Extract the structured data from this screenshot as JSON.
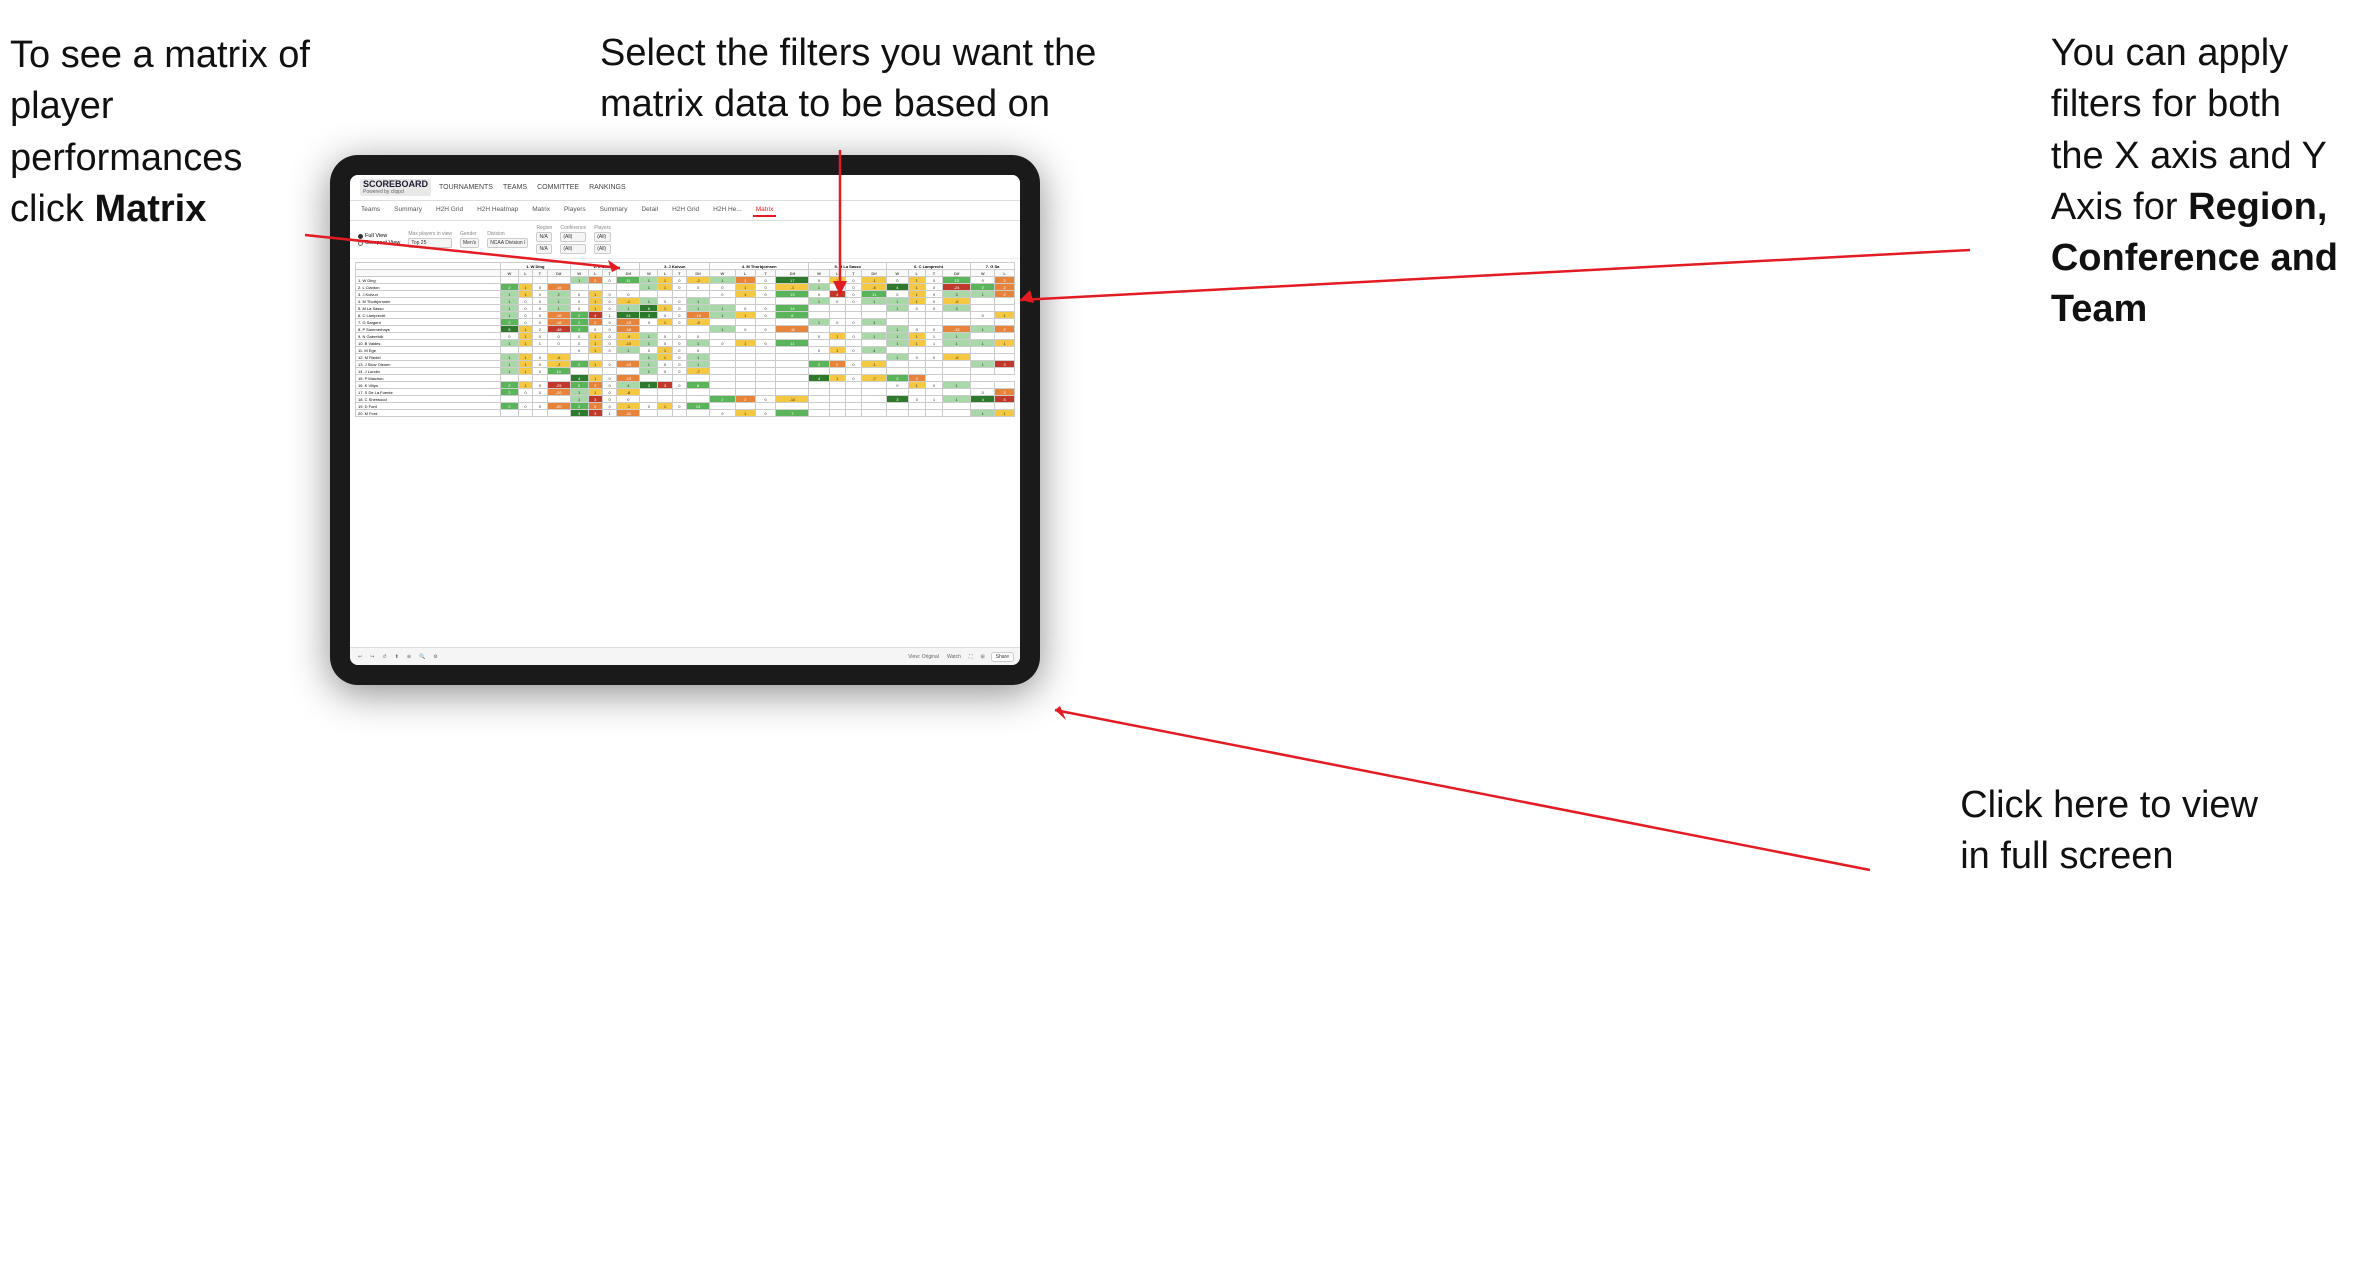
{
  "annotations": {
    "top_left": {
      "line1": "To see a matrix of",
      "line2": "player performances",
      "line3_prefix": "click ",
      "line3_bold": "Matrix"
    },
    "top_center": {
      "line1": "Select the filters you want the",
      "line2": "matrix data to be based on"
    },
    "top_right": {
      "line1": "You  can apply",
      "line2": "filters for both",
      "line3": "the X axis and Y",
      "line4_prefix": "Axis for ",
      "line4_bold": "Region,",
      "line5_bold": "Conference and",
      "line6_bold": "Team"
    },
    "bottom_right": {
      "line1": "Click here to view",
      "line2": "in full screen"
    }
  },
  "scoreboard": {
    "title": "SCOREBOARD",
    "subtitle": "Powered by clippd"
  },
  "nav": {
    "items": [
      "TOURNAMENTS",
      "TEAMS",
      "COMMITTEE",
      "RANKINGS"
    ]
  },
  "tabs": {
    "items": [
      "Teams",
      "Summary",
      "H2H Grid",
      "H2H Heatmap",
      "Matrix",
      "Players",
      "Summary",
      "Detail",
      "H2H Grid",
      "H2H He...",
      "Matrix"
    ],
    "active_index": 10
  },
  "filters": {
    "view_options": [
      "Full View",
      "Compact View"
    ],
    "selected_view": "Full View",
    "max_players_label": "Max players in view",
    "max_players_value": "Top 25",
    "gender_label": "Gender",
    "gender_value": "Men's",
    "division_label": "Division",
    "division_value": "NCAA Division I",
    "region_label": "Region",
    "region_value": "N/A",
    "conference_label": "Conference",
    "conference_value": "(All)",
    "players_label": "Players",
    "players_value": "(All)"
  },
  "matrix": {
    "col_headers": [
      "1. W Ding",
      "2. L Clanton",
      "3. J Koivun",
      "4. M Thorbjornsen",
      "5. M La Sasso",
      "6. C Lamprecht",
      "7. G Sa"
    ],
    "sub_headers": [
      "W",
      "L",
      "T",
      "Dif"
    ],
    "rows": [
      {
        "name": "1. W Ding",
        "cells": [
          [
            null,
            null,
            null,
            null
          ],
          [
            1,
            2,
            0,
            11
          ],
          [
            1,
            1,
            0,
            -2
          ],
          [
            1,
            2,
            0,
            17
          ],
          [
            0,
            1,
            0,
            -1
          ],
          [
            0,
            1,
            0,
            13
          ],
          [
            0,
            2
          ]
        ]
      },
      {
        "name": "2. L Clanton",
        "cells": [
          [
            2,
            1,
            0,
            -16
          ],
          [
            null,
            null,
            null,
            null
          ],
          [
            1,
            1,
            0,
            0
          ],
          [
            0,
            1,
            0,
            -1
          ],
          [
            1,
            0,
            0,
            -6
          ],
          [
            4,
            1,
            0,
            -24
          ],
          [
            2,
            2
          ]
        ]
      },
      {
        "name": "3. J Koivun",
        "cells": [
          [
            1,
            1,
            0,
            2
          ],
          [
            0,
            1,
            0,
            0
          ],
          [
            null,
            null,
            null,
            null
          ],
          [
            0,
            1,
            0,
            13
          ],
          [
            0,
            4,
            0,
            11
          ],
          [
            0,
            1,
            0,
            3
          ],
          [
            1,
            2
          ]
        ]
      },
      {
        "name": "4. M Thorbjornsen",
        "cells": [
          [
            1,
            0,
            0,
            1
          ],
          [
            0,
            1,
            0,
            -1
          ],
          [
            1,
            0,
            0,
            1
          ],
          [
            null,
            null,
            null,
            null
          ],
          [
            1,
            0,
            0,
            1
          ],
          [
            1,
            1,
            0,
            -6
          ],
          [
            null,
            null
          ]
        ]
      },
      {
        "name": "5. M La Sasso",
        "cells": [
          [
            1,
            0,
            0,
            1
          ],
          [
            0,
            1,
            0,
            1
          ],
          [
            6,
            1,
            0,
            1
          ],
          [
            1,
            0,
            0,
            14
          ],
          [
            null,
            null,
            null,
            null
          ],
          [
            1,
            0,
            0,
            3
          ],
          [
            null,
            null
          ]
        ]
      },
      {
        "name": "6. C Lamprecht",
        "cells": [
          [
            1,
            0,
            0,
            -16
          ],
          [
            2,
            4,
            1,
            24
          ],
          [
            3,
            0,
            0,
            -16
          ],
          [
            1,
            1,
            0,
            6
          ],
          [
            null,
            null,
            null,
            null
          ],
          [
            null,
            null,
            null,
            null
          ],
          [
            0,
            1
          ]
        ]
      },
      {
        "name": "7. G Sargent",
        "cells": [
          [
            2,
            0,
            0,
            -18
          ],
          [
            2,
            2,
            0,
            -15
          ],
          [
            0,
            1,
            0,
            -5
          ],
          [
            null,
            null,
            null,
            null
          ],
          [
            1,
            0,
            0,
            3
          ],
          [
            null,
            null,
            null,
            null
          ],
          [
            null,
            null
          ]
        ]
      },
      {
        "name": "8. P Summerhays",
        "cells": [
          [
            5,
            1,
            2,
            -48
          ],
          [
            2,
            0,
            0,
            -16
          ],
          [
            null,
            null,
            null,
            null
          ],
          [
            1,
            0,
            0,
            -11
          ],
          [
            null,
            null,
            null,
            null
          ],
          [
            1,
            0,
            0,
            -13
          ],
          [
            1,
            2
          ]
        ]
      },
      {
        "name": "9. N Gabrelcik",
        "cells": [
          [
            0,
            1,
            0,
            0
          ],
          [
            0,
            1,
            0,
            -9
          ],
          [
            1,
            0,
            0,
            0
          ],
          [
            null,
            null,
            null,
            null
          ],
          [
            0,
            1,
            0,
            1
          ],
          [
            1,
            1,
            1,
            1
          ],
          [
            null,
            null
          ]
        ]
      },
      {
        "name": "10. B Valdes",
        "cells": [
          [
            1,
            1,
            1,
            0
          ],
          [
            0,
            1,
            0,
            -10
          ],
          [
            1,
            0,
            0,
            1
          ],
          [
            0,
            1,
            0,
            11
          ],
          [
            null,
            null,
            null,
            null
          ],
          [
            1,
            1,
            1,
            1
          ],
          [
            1,
            1
          ]
        ]
      },
      {
        "name": "11. M Ege",
        "cells": [
          [
            null,
            null,
            null,
            null
          ],
          [
            0,
            1,
            0,
            1
          ],
          [
            0,
            1,
            0,
            0
          ],
          [
            null,
            null,
            null,
            null
          ],
          [
            0,
            1,
            0,
            4
          ],
          [
            null,
            null,
            null,
            null
          ],
          [
            null,
            null
          ]
        ]
      },
      {
        "name": "12. M Riedel",
        "cells": [
          [
            1,
            1,
            0,
            -6
          ],
          [
            null,
            null,
            null,
            null
          ],
          [
            1,
            1,
            0,
            1
          ],
          [
            null,
            null,
            null,
            null
          ],
          [
            null,
            null,
            null,
            null
          ],
          [
            1,
            0,
            0,
            -6
          ],
          [
            null,
            null
          ]
        ]
      },
      {
        "name": "13. J Skov Olesen",
        "cells": [
          [
            1,
            1,
            0,
            -3
          ],
          [
            2,
            1,
            0,
            -19
          ],
          [
            1,
            0,
            0,
            1
          ],
          [
            null,
            null,
            null,
            null
          ],
          [
            2,
            2,
            0,
            -1
          ],
          [
            null,
            null,
            null,
            null
          ],
          [
            1,
            3
          ]
        ]
      },
      {
        "name": "14. J Lundin",
        "cells": [
          [
            1,
            1,
            0,
            10
          ],
          [
            null,
            null,
            null,
            null
          ],
          [
            1,
            0,
            0,
            -7
          ],
          [
            null,
            null,
            null,
            null
          ],
          [
            null,
            null,
            null,
            null
          ],
          [
            null,
            null,
            null,
            null
          ],
          [
            null,
            null
          ]
        ]
      },
      {
        "name": "15. P Maichon",
        "cells": [
          [
            null,
            null,
            null,
            null
          ],
          [
            4,
            1,
            0,
            -19
          ],
          [
            null,
            null,
            null,
            null
          ],
          [
            null,
            null,
            null,
            null
          ],
          [
            4,
            1,
            0,
            -7
          ],
          [
            2,
            2
          ]
        ]
      },
      {
        "name": "16. K Vilips",
        "cells": [
          [
            2,
            1,
            0,
            -25
          ],
          [
            2,
            2,
            0,
            4
          ],
          [
            3,
            3,
            0,
            8
          ],
          [
            null,
            null,
            null,
            null
          ],
          [
            null,
            null,
            null,
            null
          ],
          [
            0,
            1,
            0,
            1
          ],
          [
            null,
            null
          ]
        ]
      },
      {
        "name": "17. S De La Fuente",
        "cells": [
          [
            2,
            0,
            0,
            -20
          ],
          [
            1,
            1,
            0,
            -8
          ],
          [
            null,
            null,
            null,
            null
          ],
          [
            null,
            null,
            null,
            null
          ],
          [
            null,
            null,
            null,
            null
          ],
          [
            null,
            null,
            null,
            null
          ],
          [
            0,
            2
          ]
        ]
      },
      {
        "name": "18. C Sherwood",
        "cells": [
          [
            null,
            null,
            null,
            null
          ],
          [
            1,
            3,
            0,
            0
          ],
          [
            null,
            null,
            null,
            null
          ],
          [
            2,
            2,
            0,
            -10
          ],
          [
            null,
            null,
            null,
            null
          ],
          [
            3,
            0,
            1,
            1
          ],
          [
            4,
            5
          ]
        ]
      },
      {
        "name": "19. D Ford",
        "cells": [
          [
            2,
            0,
            0,
            -20
          ],
          [
            2,
            2,
            0,
            -1
          ],
          [
            0,
            1,
            0,
            13
          ],
          [
            null,
            null,
            null,
            null
          ],
          [
            null,
            null,
            null,
            null
          ],
          [
            null,
            null,
            null,
            null
          ],
          [
            null,
            null
          ]
        ]
      },
      {
        "name": "20. M Ford",
        "cells": [
          [
            null,
            null,
            null,
            null
          ],
          [
            3,
            3,
            1,
            -11
          ],
          [
            null,
            null,
            null,
            null
          ],
          [
            0,
            1,
            0,
            7
          ],
          [
            null,
            null,
            null,
            null
          ],
          [
            null,
            null,
            null,
            null
          ],
          [
            1,
            1
          ]
        ]
      }
    ]
  },
  "toolbar": {
    "view_original": "View: Original",
    "watch": "Watch",
    "share": "Share"
  }
}
